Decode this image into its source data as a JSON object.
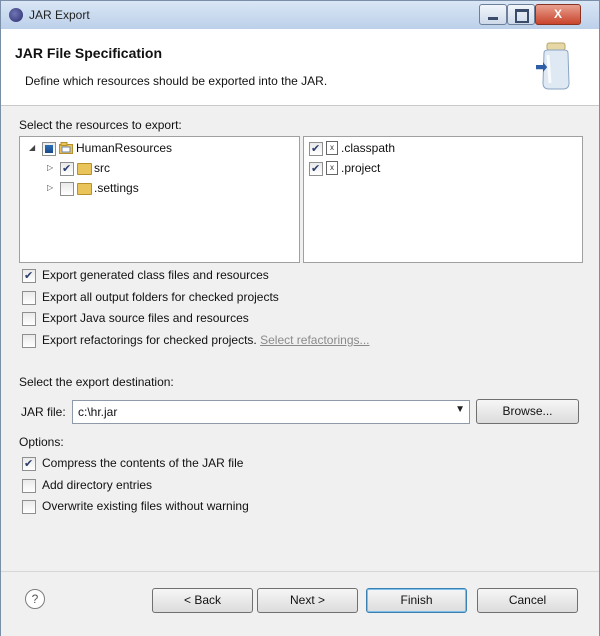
{
  "window": {
    "title": "JAR Export",
    "minimize_glyph": "",
    "maximize_glyph": "",
    "close_glyph": "X"
  },
  "header": {
    "title": "JAR File Specification",
    "description": "Define which resources should be exported into the JAR."
  },
  "resources": {
    "label": "Select the resources to export:",
    "tree": [
      {
        "label": "HumanResources",
        "state": "partial",
        "expanded": true
      },
      {
        "label": "src",
        "state": "checked"
      },
      {
        "label": ".settings",
        "state": "unchecked"
      }
    ],
    "files": [
      {
        "label": ".classpath",
        "checked": true
      },
      {
        "label": ".project",
        "checked": true
      }
    ]
  },
  "export_options": [
    {
      "label": "Export generated class files and resources",
      "checked": true
    },
    {
      "label": "Export all output folders for checked projects",
      "checked": false
    },
    {
      "label": "Export Java source files and resources",
      "checked": false
    },
    {
      "label": "Export refactorings for checked projects.",
      "checked": false,
      "link": "Select refactorings..."
    }
  ],
  "destination": {
    "label": "Select the export destination:",
    "jar_label": "JAR file:",
    "jar_value": "c:\\hr.jar",
    "browse": "Browse..."
  },
  "options": {
    "label": "Options:",
    "items": [
      {
        "label": "Compress the contents of the JAR file",
        "checked": true
      },
      {
        "label": "Add directory entries",
        "checked": false
      },
      {
        "label": "Overwrite existing files without warning",
        "checked": false
      }
    ]
  },
  "buttons": {
    "help": "?",
    "back": "< Back",
    "next": "Next >",
    "finish": "Finish",
    "cancel": "Cancel"
  }
}
